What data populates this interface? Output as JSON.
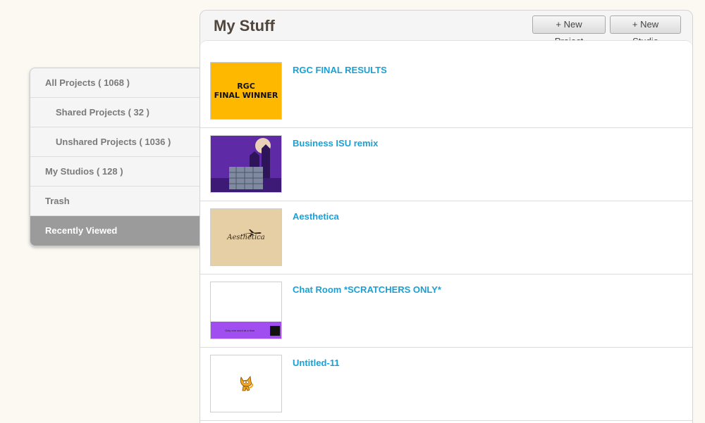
{
  "sidebar": {
    "items": [
      {
        "label": "All Projects ( 1068 )"
      },
      {
        "label": "Shared Projects ( 32 )"
      },
      {
        "label": "Unshared Projects ( 1036 )"
      },
      {
        "label": "My Studios ( 128 )"
      },
      {
        "label": "Trash"
      },
      {
        "label": "Recently Viewed"
      }
    ]
  },
  "header": {
    "title": "My Stuff",
    "new_project_label": "+ New Project",
    "new_studio_label": "+ New Studio"
  },
  "projects": [
    {
      "title": "RGC FINAL RESULTS",
      "thumb_line1": "RGC",
      "thumb_line2": "FINAL WINNER",
      "thumb_color": "#ffb800"
    },
    {
      "title": "Business ISU remix",
      "thumb_color": "#6a2fb8"
    },
    {
      "title": "Aesthetica",
      "thumb_text": "Aesthetica",
      "thumb_color": "#e6cfa5"
    },
    {
      "title": "Chat Room *SCRATCHERS ONLY*",
      "thumb_text": "Only one word at a time",
      "thumb_bar_color": "#a04ef0"
    },
    {
      "title": "Untitled-11",
      "thumb_icon": "scratch-cat-icon"
    }
  ],
  "colors": {
    "link": "#19a1d6",
    "active_sidebar": "#9b9b9b",
    "title": "#51463d"
  }
}
